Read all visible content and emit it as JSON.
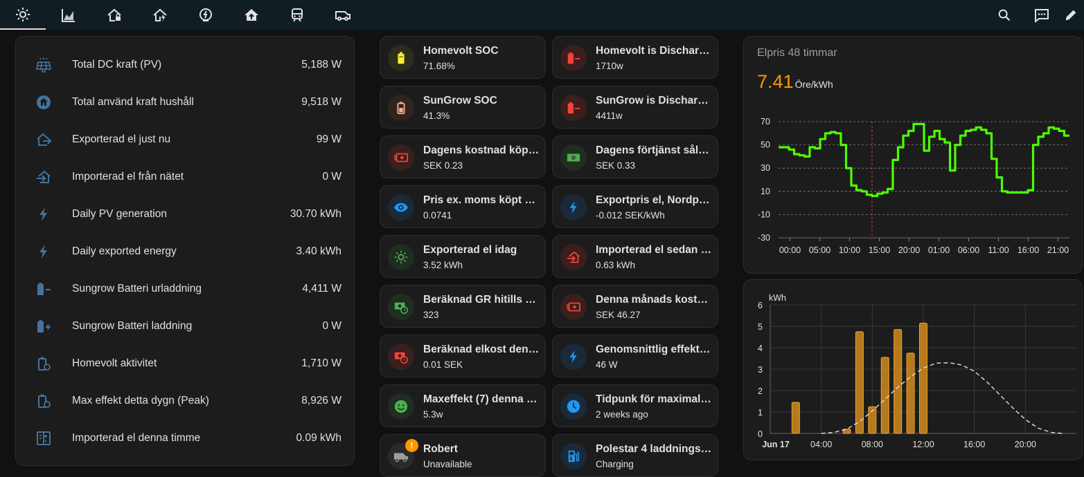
{
  "topbar": {
    "tabs": [
      {
        "icon": "solar-power-icon",
        "active": true
      },
      {
        "icon": "chart-areaspline-icon",
        "active": false
      },
      {
        "icon": "home-lock-icon",
        "active": false
      },
      {
        "icon": "home-lightning-icon",
        "active": false
      },
      {
        "icon": "meter-electric-icon",
        "active": false
      },
      {
        "icon": "home-export-icon",
        "active": false
      },
      {
        "icon": "train-car-icon",
        "active": false
      },
      {
        "icon": "van-utility-icon",
        "active": false
      }
    ],
    "actions": [
      "search-icon",
      "assist-icon",
      "edit-icon"
    ]
  },
  "entities": [
    {
      "icon": "solar-panel-icon",
      "name": "Total DC kraft (PV)",
      "value": "5,188 W"
    },
    {
      "icon": "home-circle-icon",
      "name": "Total använd kraft hushåll",
      "value": "9,518 W"
    },
    {
      "icon": "home-export-icon",
      "name": "Exporterad el just nu",
      "value": "99 W"
    },
    {
      "icon": "home-import-icon",
      "name": "Importerad el från nätet",
      "value": "0 W"
    },
    {
      "icon": "flash-icon",
      "name": "Daily PV generation",
      "value": "30.70 kWh"
    },
    {
      "icon": "flash-icon",
      "name": "Daily exported energy",
      "value": "3.40 kWh"
    },
    {
      "icon": "battery-minus-icon",
      "name": "Sungrow Batteri urladdning",
      "value": "4,411 W"
    },
    {
      "icon": "battery-plus-icon",
      "name": "Sungrow Batteri laddning",
      "value": "0 W"
    },
    {
      "icon": "battery-sync-icon",
      "name": "Homevolt aktivitet",
      "value": "1,710 W"
    },
    {
      "icon": "battery-sync-icon",
      "name": "Max effekt detta dygn (Peak)",
      "value": "8,926 W"
    },
    {
      "icon": "meter-icon",
      "name": "Importerad el denna timme",
      "value": "0.09 kWh"
    }
  ],
  "tiles": [
    {
      "name": "Homevolt SOC",
      "state": "71.68%",
      "icon": "battery-high-icon",
      "color": "#ffeb3b",
      "bg": "#2e2d1c"
    },
    {
      "name": "Homevolt is Discharg…",
      "state": "1710w",
      "icon": "battery-minus-icon",
      "color": "#f44336",
      "bg": "#3b1e1e"
    },
    {
      "name": "SunGrow SOC",
      "state": "41.3%",
      "icon": "battery-medium-icon",
      "color": "#ffab91",
      "bg": "#30241f"
    },
    {
      "name": "SunGrow is Discharg…",
      "state": "4411w",
      "icon": "battery-minus-icon",
      "color": "#f44336",
      "bg": "#3b1e1e"
    },
    {
      "name": "Dagens kostnad köpt …",
      "state": "SEK 0.23",
      "icon": "cash-minus-icon",
      "color": "#f44336",
      "bg": "#3b1e1e"
    },
    {
      "name": "Dagens förtjänst såld…",
      "state": "SEK 0.33",
      "icon": "cash-icon",
      "color": "#4caf50",
      "bg": "#1f2e20"
    },
    {
      "name": "Pris ex. moms köpt el…",
      "state": "0.0741",
      "icon": "eye-icon",
      "color": "#2196f3",
      "bg": "#1b2a3a"
    },
    {
      "name": "Exportpris el, Nordpol…",
      "state": "-0.012 SEK/kWh",
      "icon": "flash-icon",
      "color": "#2196f3",
      "bg": "#1b2a3a"
    },
    {
      "name": "Exporterad el idag",
      "state": "3.52 kWh",
      "icon": "solar-power-icon",
      "color": "#4caf50",
      "bg": "#1f2e20"
    },
    {
      "name": "Importerad el sedan …",
      "state": "0.63 kWh",
      "icon": "home-import-icon",
      "color": "#f44336",
      "bg": "#3b1e1e"
    },
    {
      "name": "Beräknad GR hitills d…",
      "state": "323",
      "icon": "cash-clock-icon",
      "color": "#4caf50",
      "bg": "#1f2e20"
    },
    {
      "name": "Denna månads kostn…",
      "state": "SEK 46.27",
      "icon": "cash-minus-icon",
      "color": "#f44336",
      "bg": "#3b1e1e"
    },
    {
      "name": "Beräknad elkost denn…",
      "state": "0.01 SEK",
      "icon": "cash-clock-icon",
      "color": "#f44336",
      "bg": "#3b1e1e"
    },
    {
      "name": "Genomsnittlig effekt i…",
      "state": "46 W",
      "icon": "flash-icon",
      "color": "#2196f3",
      "bg": "#1b2a3a"
    },
    {
      "name": "Maxeffekt (7) denna …",
      "state": "5.3w",
      "icon": "emoticon-happy-icon",
      "color": "#4caf50",
      "bg": "#1f2e20"
    },
    {
      "name": "Tidpunk för maximal …",
      "state": "2 weeks ago",
      "icon": "clock-icon",
      "color": "#2196f3",
      "bg": "#1b2a3a"
    },
    {
      "name": "Robert",
      "state": "Unavailable",
      "icon": "van-icon",
      "color": "#9e9e9e",
      "bg": "#2a2a2a",
      "badge": "!"
    },
    {
      "name": "Polestar 4 laddningss…",
      "state": "Charging",
      "icon": "ev-station-icon",
      "color": "#2196f3",
      "bg": "#1b2a3a"
    }
  ],
  "price_card": {
    "title": "Elpris 48 timmar",
    "value": "7.41",
    "unit": "Öre/kWh",
    "value_color": "#ff9800",
    "line_color": "#4cff00"
  },
  "solar_card": {
    "bar_color": "#d08a1f",
    "forecast_color": "#e1e1e1"
  },
  "chart_data": [
    {
      "type": "line",
      "title": "Elpris 48 timmar",
      "ylabel": "",
      "xlabel": "",
      "ylim": [
        -30,
        70
      ],
      "yticks": [
        70,
        50,
        30,
        10,
        -10,
        -30
      ],
      "xticks": [
        "00:00",
        "05:00",
        "10:00",
        "15:00",
        "20:00",
        "01:00",
        "06:00",
        "11:00",
        "16:00",
        "21:00"
      ],
      "step": true,
      "current_index": 18,
      "series": [
        {
          "values": [
            48,
            48,
            46,
            42,
            41,
            40,
            48,
            47,
            55,
            60,
            61,
            60,
            50,
            30,
            15,
            11,
            10,
            7,
            6,
            8,
            9,
            12,
            37,
            48,
            58,
            62,
            68,
            68,
            45,
            57,
            62,
            55,
            52,
            28,
            50,
            58,
            62,
            63,
            65,
            63,
            60,
            38,
            22,
            10,
            9,
            9,
            9,
            9,
            11,
            50,
            57,
            60,
            65,
            64,
            62,
            58
          ]
        }
      ]
    },
    {
      "type": "bar",
      "ylabel": "kWh",
      "xlabel": "",
      "ylim": [
        0,
        6
      ],
      "yticks": [
        0,
        1,
        2,
        3,
        4,
        5,
        6
      ],
      "xticks": [
        "Jun 17",
        "04:00",
        "08:00",
        "12:00",
        "16:00",
        "20:00"
      ],
      "x_hours": [
        2.0,
        6.0,
        7.0,
        8.0,
        9.0,
        10.0,
        11.0,
        12.0
      ],
      "values": [
        1.45,
        0.2,
        4.75,
        1.25,
        3.55,
        4.85,
        3.75,
        5.15
      ],
      "forecast": {
        "x_hours": [
          4,
          5,
          6,
          7,
          8,
          9,
          10,
          11,
          12,
          13,
          14,
          15,
          16,
          17,
          18,
          19,
          20,
          21,
          22,
          23
        ],
        "values": [
          0.0,
          0.05,
          0.2,
          0.55,
          1.05,
          1.6,
          2.15,
          2.65,
          3.05,
          3.28,
          3.3,
          3.2,
          2.9,
          2.4,
          1.8,
          1.2,
          0.65,
          0.25,
          0.05,
          0.0
        ]
      }
    }
  ]
}
